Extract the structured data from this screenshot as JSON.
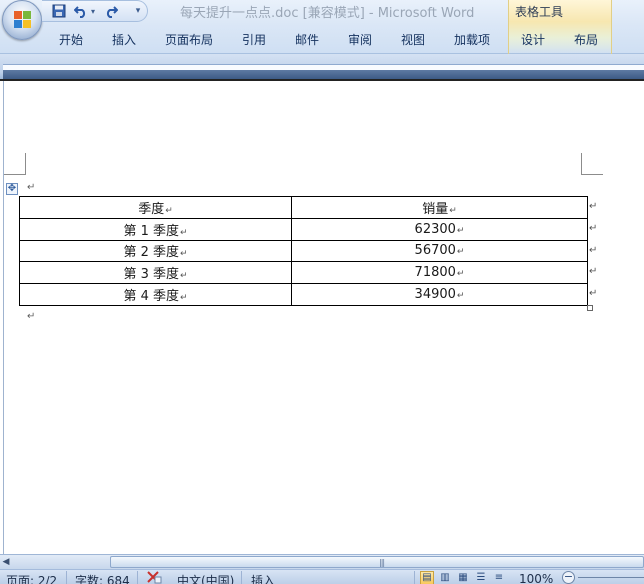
{
  "title_bar": {
    "window_title": "每天提升一点点.doc [兼容模式] - Microsoft Word",
    "contextual_tools_title": "表格工具"
  },
  "quick_access": {
    "icons": [
      "save-icon",
      "undo-icon",
      "redo-icon",
      "customize-icon"
    ]
  },
  "ribbon": {
    "tabs": [
      "开始",
      "插入",
      "页面布局",
      "引用",
      "邮件",
      "审阅",
      "视图",
      "加载项"
    ],
    "contextual_tabs": [
      "设计",
      "布局"
    ]
  },
  "document": {
    "table": {
      "header": [
        "季度",
        "销量"
      ],
      "rows": [
        [
          "第 1 季度",
          "62300"
        ],
        [
          "第 2 季度",
          "56700"
        ],
        [
          "第 3 季度",
          "71800"
        ],
        [
          "第 4 季度",
          "34900"
        ]
      ]
    },
    "paragraph_mark": "↵",
    "cell_mark": "↵"
  },
  "status_bar": {
    "page": "页面: 2/2",
    "word_count": "字数: 684",
    "language": "中文(中国)",
    "mode": "插入",
    "zoom": "100%",
    "zoom_minus": "−"
  },
  "colors": {
    "ribbon_blue": "#dbe7f6",
    "tools_highlight": "#f7e7b0",
    "tab_text": "#14315e"
  }
}
